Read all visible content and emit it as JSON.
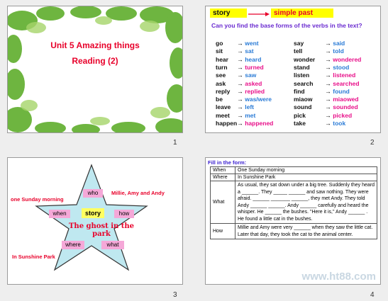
{
  "slide_numbers": [
    "1",
    "2",
    "3",
    "4"
  ],
  "slide1": {
    "title": "Unit 5 Amazing things",
    "subtitle": "Reading (2)"
  },
  "slide2": {
    "label_story": "story",
    "label_past": "simple past",
    "question": "Can you find the base forms of the verbs in the text?",
    "left": [
      {
        "base": "go",
        "past": "went"
      },
      {
        "base": "sit",
        "past": "sat"
      },
      {
        "base": "hear",
        "past": "heard"
      },
      {
        "base": "turn",
        "past": "turned"
      },
      {
        "base": "see",
        "past": "saw"
      },
      {
        "base": "ask",
        "past": "asked"
      },
      {
        "base": "reply",
        "past": "replied"
      },
      {
        "base": "be",
        "past": "was/were"
      },
      {
        "base": "leave",
        "past": "left"
      },
      {
        "base": "meet",
        "past": "met"
      },
      {
        "base": "happen",
        "past": "happened"
      }
    ],
    "right": [
      {
        "base": "say",
        "past": "said"
      },
      {
        "base": "tell",
        "past": "told"
      },
      {
        "base": "wonder",
        "past": "wondered"
      },
      {
        "base": "stand",
        "past": "stood"
      },
      {
        "base": "listen",
        "past": "listened"
      },
      {
        "base": "search",
        "past": "searched"
      },
      {
        "base": "find",
        "past": "found"
      },
      {
        "base": "miaow",
        "past": "miaowed"
      },
      {
        "base": "sound",
        "past": "sounded"
      },
      {
        "base": "pick",
        "past": "picked"
      },
      {
        "base": "take",
        "past": "took"
      }
    ]
  },
  "slide3": {
    "center": "story",
    "who": "who",
    "when": "when",
    "how": "how",
    "where": "where",
    "what": "what",
    "who_answer": "Millie, Amy and Andy",
    "when_answer": "one Sunday morning",
    "where_answer": "In Sunshine Park",
    "title": "The ghost in the park"
  },
  "slide4": {
    "heading": "Fill in the form:",
    "rows": [
      {
        "key": "When",
        "value": "One Sunday morning"
      },
      {
        "key": "Where",
        "value": "In Sunshine Park"
      },
      {
        "key": "What",
        "value": "As usual, they sat down under a big tree. Suddenly they heard a ______. They _____ ______ and saw nothing. They were afraid. ______ _______ ______, they met Andy. They told Andy ______ ______. Andy ______ carefully and heard the whisper. He ______ the bushes. \"Here it is,\" Andy ______ . He found a little cat in the bushes."
      },
      {
        "key": "How",
        "value": "Millie and Amy were very ______ when they saw the little cat. Later that day, they took the cat to the animal center."
      }
    ],
    "what_lead": "As usual"
  },
  "watermark": "www.ht88.com"
}
